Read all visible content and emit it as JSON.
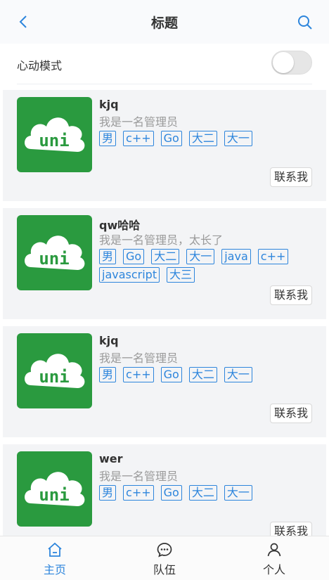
{
  "header": {
    "title": "标题"
  },
  "heart_mode": {
    "label": "心动模式",
    "enabled": false
  },
  "cards": [
    {
      "name": "kjq",
      "desc": "我是一名管理员",
      "tags": [
        "男",
        "c++",
        "Go",
        "大二",
        "大一"
      ],
      "contact_label": "联系我"
    },
    {
      "name": "qw哈哈",
      "desc": "我是一名管理员，太长了",
      "tags": [
        "男",
        "Go",
        "大二",
        "大一",
        "java",
        "c++",
        "javascript",
        "大三"
      ],
      "contact_label": "联系我"
    },
    {
      "name": "kjq",
      "desc": "我是一名管理员",
      "tags": [
        "男",
        "c++",
        "Go",
        "大二",
        "大一"
      ],
      "contact_label": "联系我"
    },
    {
      "name": "wer",
      "desc": "我是一名管理员",
      "tags": [
        "男",
        "c++",
        "Go",
        "大二",
        "大一"
      ],
      "contact_label": "联系我"
    }
  ],
  "logo_text": "uni",
  "tabbar": [
    {
      "label": "主页",
      "icon": "home-icon",
      "active": true
    },
    {
      "label": "队伍",
      "icon": "chat-icon",
      "active": false
    },
    {
      "label": "个人",
      "icon": "person-icon",
      "active": false
    }
  ],
  "colors": {
    "accent": "#2d85dc",
    "logo_green": "#2a9a3f"
  }
}
